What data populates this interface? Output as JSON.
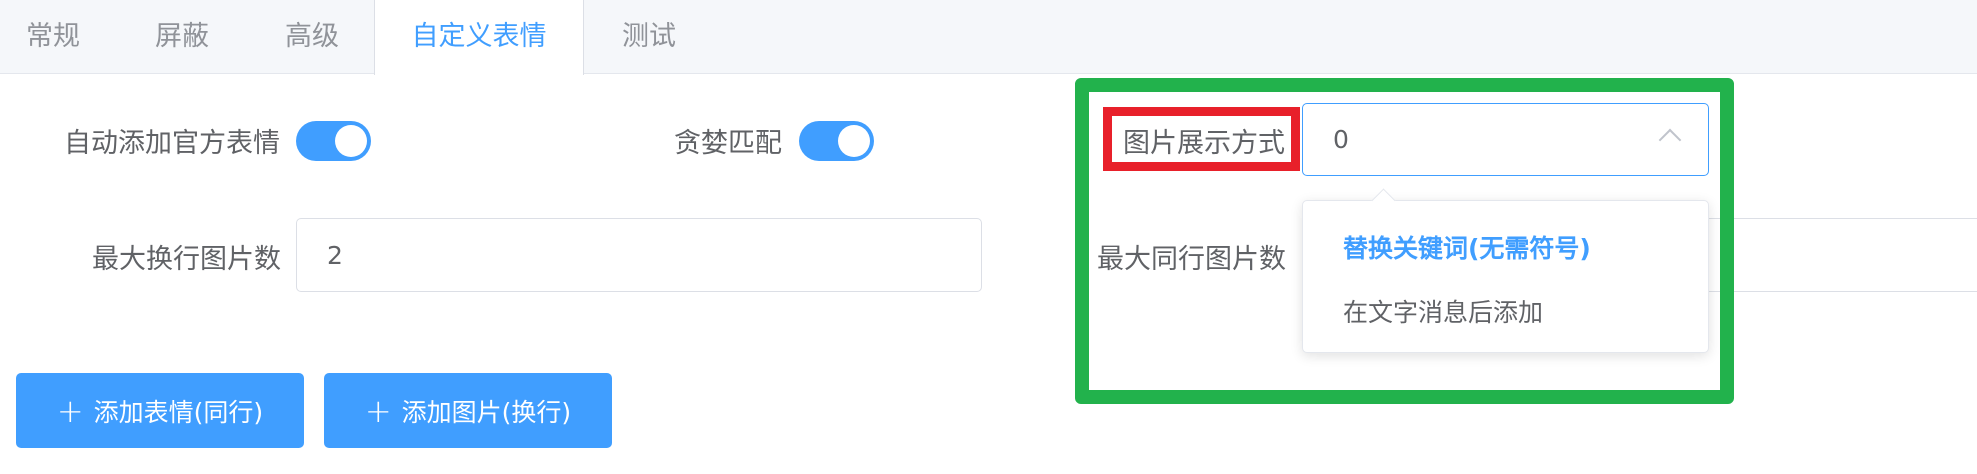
{
  "tabs": [
    {
      "label": "常规",
      "active": false
    },
    {
      "label": "屏蔽",
      "active": false
    },
    {
      "label": "高级",
      "active": false
    },
    {
      "label": "自定义表情",
      "active": true
    },
    {
      "label": "测试",
      "active": false
    }
  ],
  "form": {
    "auto_add_label": "自动添加官方表情",
    "auto_add_on": true,
    "greedy_label": "贪婪匹配",
    "greedy_on": true,
    "display_mode_label": "图片展示方式",
    "display_mode_value": "0",
    "max_newline_label": "最大换行图片数",
    "max_newline_value": "2",
    "max_sameline_label": "最大同行图片数"
  },
  "dropdown": {
    "options": [
      {
        "label": "替换关键词(无需符号)",
        "selected": true
      },
      {
        "label": "在文字消息后添加",
        "selected": false
      }
    ]
  },
  "buttons": {
    "add_emoji": "添加表情(同行)",
    "add_image": "添加图片(换行)"
  },
  "colors": {
    "primary": "#409eff",
    "highlight_green": "#22b24c",
    "highlight_red": "#e8202a"
  }
}
